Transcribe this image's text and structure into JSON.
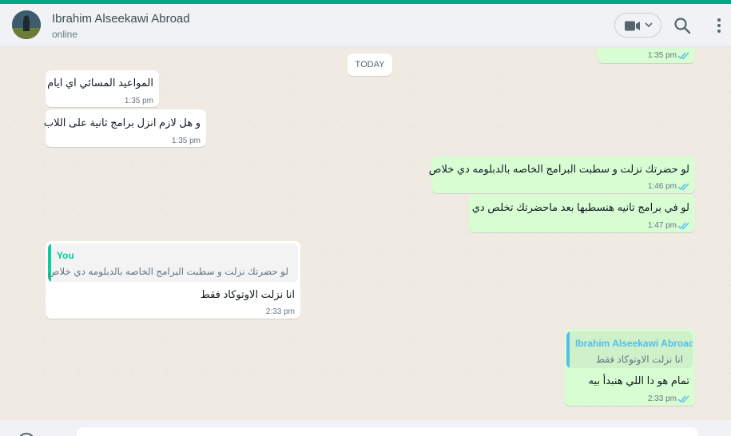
{
  "header": {
    "contact_name": "Ibrahim Alseekawi Abroad",
    "status": "online"
  },
  "chat": {
    "date_label": "TODAY",
    "messages": [
      {
        "id": "m0",
        "direction": "out",
        "text": "",
        "time": "1:35 pm",
        "ticks": "read"
      },
      {
        "id": "m1",
        "direction": "in",
        "text": "المواعيد المسائي اي ايام",
        "time": "1:35 pm"
      },
      {
        "id": "m2",
        "direction": "in",
        "text": "و هل لازم انزل برامج ثانية على اللاب",
        "time": "1:35 pm"
      },
      {
        "id": "m3",
        "direction": "out",
        "text": "لو حضرتك نزلت و سطبت البرامج الخاصه بالدبلومه دي خلاص",
        "time": "1:46 pm",
        "ticks": "read"
      },
      {
        "id": "m4",
        "direction": "out",
        "text": "لو في برامج تانيه هنسطبها بعد ماحضرتك تخلص دي",
        "time": "1:47 pm",
        "ticks": "read"
      },
      {
        "id": "m5",
        "direction": "in",
        "quote_author": "You",
        "quote_text": "لو حضرتك نزلت و سطبت البرامج الخاصه بالدبلومه دي خلاص",
        "text": "انا نزلت الاوتوكاد فقط",
        "time": "2:33 pm"
      },
      {
        "id": "m6",
        "direction": "out",
        "quote_author": "Ibrahim Alseekawi Abroad",
        "quote_text": "انا نزلت الاوتوكاد فقط",
        "text": "تمام هو دا اللي هنبدأ بيه",
        "time": "2:33 pm",
        "ticks": "read"
      }
    ]
  },
  "colors": {
    "accent": "#00a884",
    "outgoing_bubble": "#d9fdd3",
    "incoming_bubble": "#ffffff",
    "read_tick": "#53bdeb",
    "quote_you": "#06cf9c",
    "quote_contact": "#53bdeb"
  },
  "icons": {
    "video": "video-camera-icon",
    "search": "search-icon",
    "menu": "more-vertical-icon",
    "read": "double-check-icon",
    "emoji": "emoji-icon"
  }
}
